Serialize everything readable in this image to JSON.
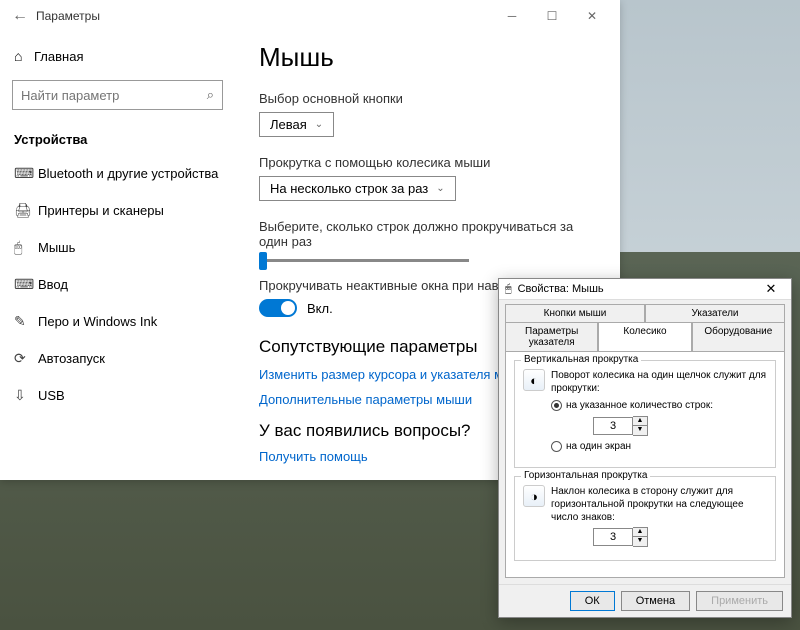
{
  "settings": {
    "window_title": "Параметры",
    "home_label": "Главная",
    "search_placeholder": "Найти параметр",
    "section_label": "Устройства",
    "nav": [
      {
        "icon": "⌨",
        "label": "Bluetooth и другие устройства"
      },
      {
        "icon": "🖨",
        "label": "Принтеры и сканеры"
      },
      {
        "icon": "🖱",
        "label": "Мышь"
      },
      {
        "icon": "⌨",
        "label": "Ввод"
      },
      {
        "icon": "✎",
        "label": "Перо и Windows Ink"
      },
      {
        "icon": "⟳",
        "label": "Автозапуск"
      },
      {
        "icon": "⇩",
        "label": "USB"
      }
    ],
    "content": {
      "heading": "Мышь",
      "primary_btn_label": "Выбор основной кнопки",
      "primary_btn_value": "Левая",
      "scroll_wheel_label": "Прокрутка с помощью колесика мыши",
      "scroll_wheel_value": "На несколько строк за раз",
      "lines_label": "Выберите, сколько строк должно прокручиваться за один раз",
      "inactive_label": "Прокручивать неактивные окна при наведении на них",
      "toggle_value": "Вкл.",
      "related_heading": "Сопутствующие параметры",
      "link_cursor": "Изменить размер курсора и указателя мыши",
      "link_additional": "Дополнительные параметры мыши",
      "questions_heading": "У вас появились вопросы?",
      "help_link": "Получить помощь"
    }
  },
  "props": {
    "title": "Свойства: Мышь",
    "tabs_row1": [
      "Кнопки мыши",
      "Указатели"
    ],
    "tabs_row2": [
      "Параметры указателя",
      "Колесико",
      "Оборудование"
    ],
    "vertical": {
      "legend": "Вертикальная прокрутка",
      "desc": "Поворот колесика на один щелчок служит для прокрутки:",
      "radio_lines": "на указанное количество строк:",
      "lines_value": "3",
      "radio_screen": "на один экран"
    },
    "horizontal": {
      "legend": "Горизонтальная прокрутка",
      "desc": "Наклон колесика в сторону служит для горизонтальной прокрутки на следующее число знаков:",
      "value": "3"
    },
    "buttons": {
      "ok": "ОК",
      "cancel": "Отмена",
      "apply": "Применить"
    }
  }
}
